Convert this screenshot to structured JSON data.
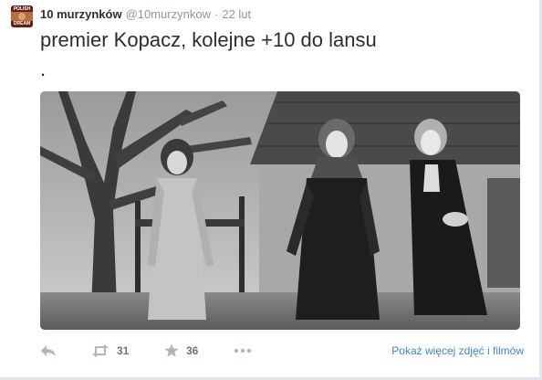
{
  "user": {
    "fullname": "10 murzynków",
    "username": "@10murzynkow",
    "separator": "·",
    "time": "22 lut",
    "avatar_text_top": "POLISH",
    "avatar_text_bottom": "DREAM"
  },
  "tweet": {
    "text": "premier Kopacz, kolejne +10 do lansu",
    "text_line2": "."
  },
  "actions": {
    "reply_icon": "reply-icon",
    "retweet_icon": "retweet-icon",
    "retweet_count": "31",
    "favorite_icon": "star-icon",
    "favorite_count": "36",
    "more_icon": "more-dots-icon",
    "media_link": "Pokaż więcej zdjęć i filmów"
  },
  "colors": {
    "link": "#3b88c3",
    "muted": "#8899a6",
    "icon": "#aab8c2",
    "text": "#292f33"
  }
}
